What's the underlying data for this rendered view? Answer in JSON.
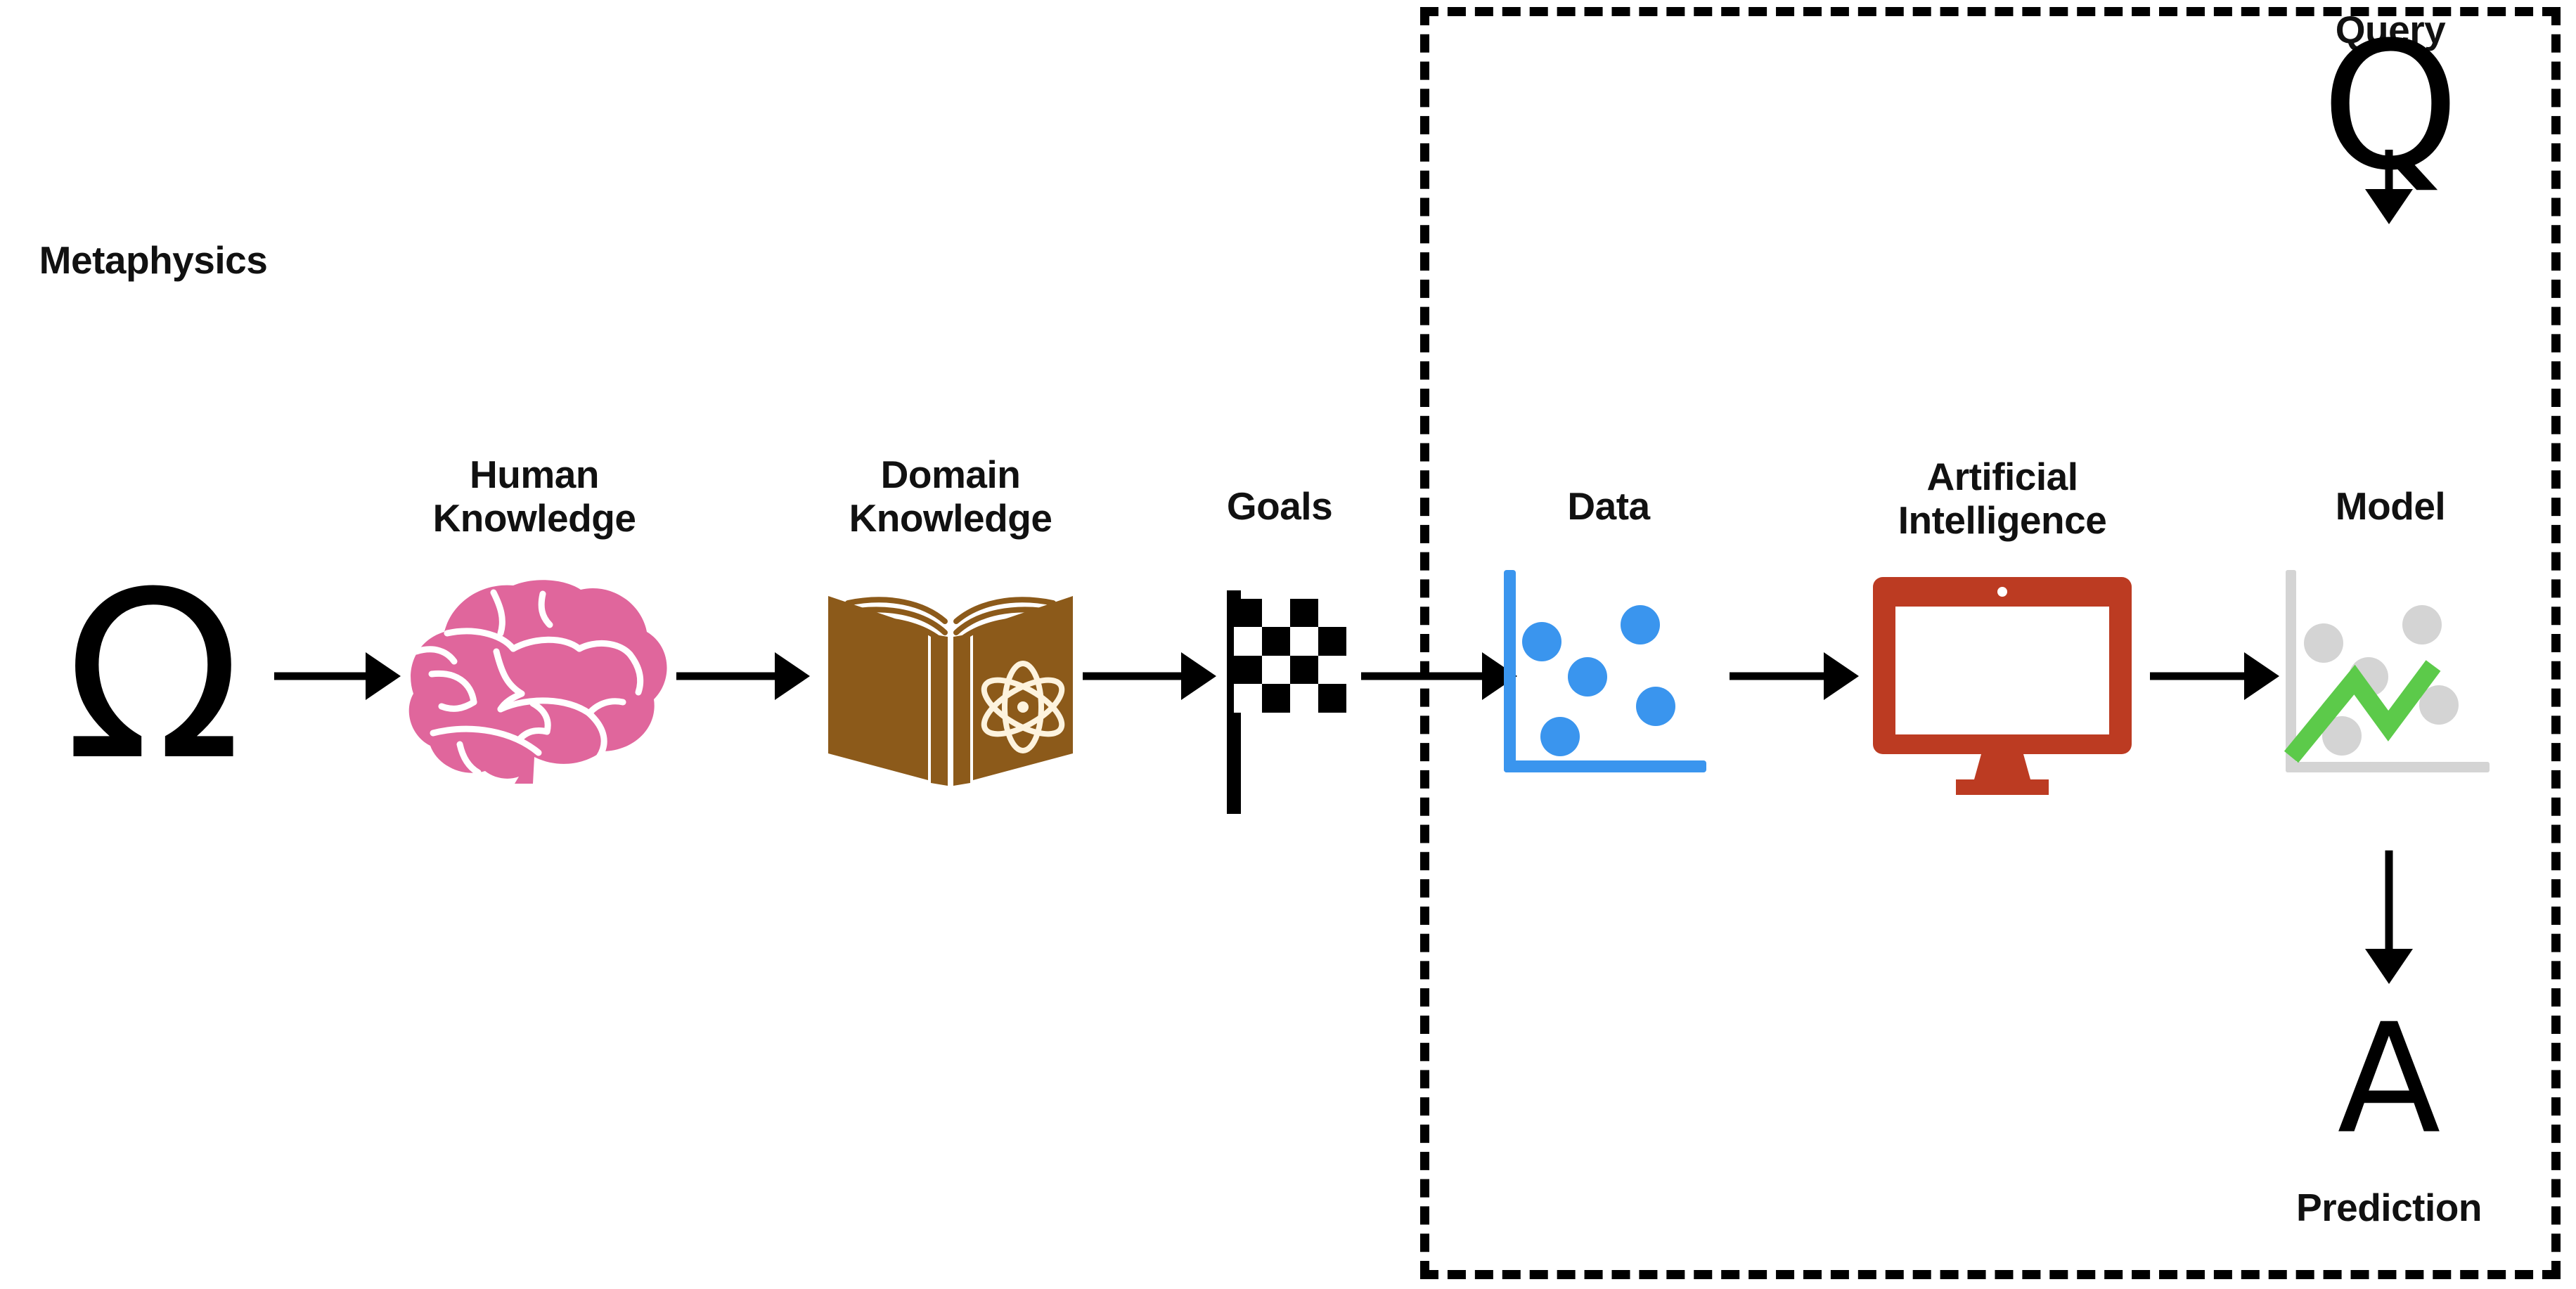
{
  "diagram": {
    "title_text": "",
    "background": "#ffffff",
    "boundary": {
      "style": "dashed",
      "color": "#000000",
      "name": "machine-learning-scope-boundary"
    },
    "nodes": [
      {
        "id": "metaphysics",
        "label": "Metaphysics",
        "icon": "omega-symbol",
        "glyph": "Ω",
        "color": "#000000",
        "inside_boundary": false
      },
      {
        "id": "human-knowledge",
        "label": "Human\nKnowledge",
        "icon": "brain-icon",
        "color": "#e0669c",
        "inside_boundary": false
      },
      {
        "id": "domain-knowledge",
        "label": "Domain\nKnowledge",
        "icon": "open-book-with-atom-icon",
        "color": "#8c5a1a",
        "accent": "#fdf3de",
        "inside_boundary": false
      },
      {
        "id": "goals",
        "label": "Goals",
        "icon": "checkered-flag-icon",
        "color": "#000000",
        "inside_boundary": false
      },
      {
        "id": "data",
        "label": "Data",
        "icon": "scatter-plot-icon",
        "color": "#3a95ee",
        "inside_boundary": true
      },
      {
        "id": "artificial-intelligence",
        "label": "Artificial\nIntelligence",
        "icon": "desktop-monitor-icon",
        "color": "#bc3b22",
        "inside_boundary": true
      },
      {
        "id": "model",
        "label": "Model",
        "icon": "fitted-line-chart-icon",
        "color": "#5cca4a",
        "accent": "#d4d4d4",
        "inside_boundary": true
      },
      {
        "id": "query",
        "label": "Query",
        "icon": "letter-q-glyph",
        "glyph": "Q",
        "color": "#000000",
        "inside_boundary": true
      },
      {
        "id": "prediction",
        "label": "Prediction",
        "icon": "letter-a-glyph",
        "glyph": "A",
        "color": "#000000",
        "inside_boundary": true
      }
    ],
    "edges": [
      {
        "from": "metaphysics",
        "to": "human-knowledge",
        "direction": "right"
      },
      {
        "from": "human-knowledge",
        "to": "domain-knowledge",
        "direction": "right"
      },
      {
        "from": "domain-knowledge",
        "to": "goals",
        "direction": "right"
      },
      {
        "from": "goals",
        "to": "data",
        "direction": "right"
      },
      {
        "from": "data",
        "to": "artificial-intelligence",
        "direction": "right"
      },
      {
        "from": "artificial-intelligence",
        "to": "model",
        "direction": "right"
      },
      {
        "from": "query",
        "to": "model",
        "direction": "down"
      },
      {
        "from": "model",
        "to": "prediction",
        "direction": "down"
      }
    ]
  },
  "chart_data": [
    {
      "type": "scatter",
      "title": "Data",
      "points": [
        {
          "x": 0.18,
          "y": 0.63
        },
        {
          "x": 0.62,
          "y": 0.74
        },
        {
          "x": 0.38,
          "y": 0.44
        },
        {
          "x": 0.71,
          "y": 0.3
        },
        {
          "x": 0.26,
          "y": 0.13
        }
      ],
      "marker_color": "#3a95ee",
      "axis_color": "#3a95ee",
      "grid": false,
      "xlabel": "",
      "ylabel": "",
      "xlim": [
        0,
        1
      ],
      "ylim": [
        0,
        1
      ]
    },
    {
      "type": "line",
      "title": "Model",
      "series": [
        {
          "name": "fitted-model",
          "color": "#5cca4a",
          "x": [
            0.02,
            0.32,
            0.48,
            0.7
          ],
          "y": [
            0.06,
            0.5,
            0.26,
            0.58
          ]
        }
      ],
      "scatter_overlay": {
        "name": "data-points",
        "color": "#d4d4d4",
        "points": [
          {
            "x": 0.16,
            "y": 0.6
          },
          {
            "x": 0.62,
            "y": 0.72
          },
          {
            "x": 0.38,
            "y": 0.45
          },
          {
            "x": 0.72,
            "y": 0.28
          },
          {
            "x": 0.25,
            "y": 0.15
          }
        ]
      },
      "axis_color": "#d4d4d4",
      "grid": false,
      "xlabel": "",
      "ylabel": "",
      "xlim": [
        0,
        1
      ],
      "ylim": [
        0,
        1
      ]
    }
  ]
}
